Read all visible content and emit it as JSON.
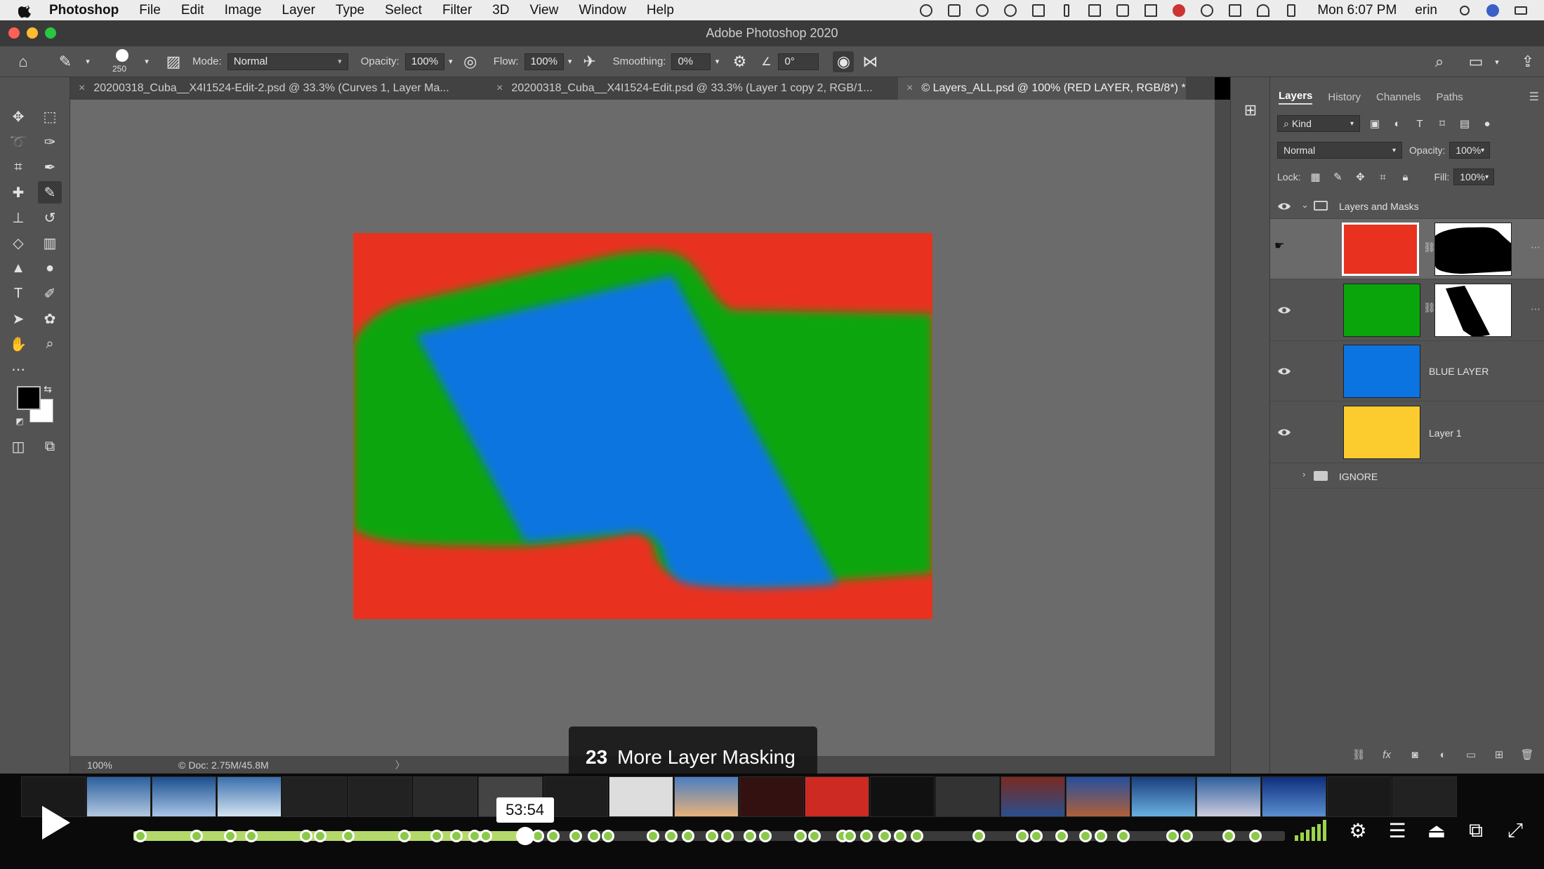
{
  "menubar": {
    "app_name": "Photoshop",
    "items": [
      "File",
      "Edit",
      "Image",
      "Layer",
      "Type",
      "Select",
      "Filter",
      "3D",
      "View",
      "Window",
      "Help"
    ],
    "clock": "Mon 6:07 PM",
    "user": "erin"
  },
  "window": {
    "title": "Adobe Photoshop 2020"
  },
  "options": {
    "brush_size": "250",
    "mode_label": "Mode:",
    "mode_value": "Normal",
    "opacity_label": "Opacity:",
    "opacity_value": "100%",
    "flow_label": "Flow:",
    "flow_value": "100%",
    "smoothing_label": "Smoothing:",
    "smoothing_value": "0%",
    "angle_value": "0°"
  },
  "tabs": [
    {
      "label": "20200318_Cuba__X4I1524-Edit-2.psd @ 33.3% (Curves 1, Layer Ma..."
    },
    {
      "label": "20200318_Cuba__X4I1524-Edit.psd @ 33.3% (Layer 1 copy 2, RGB/1..."
    },
    {
      "label": "© Layers_ALL.psd @ 100% (RED LAYER, RGB/8*) *"
    }
  ],
  "status": {
    "zoom": "100%",
    "doc": "Doc: 2.75M/45.8M",
    "arrow": "〉"
  },
  "colors": {
    "red": "#e8321f",
    "green": "#0aa50a",
    "blue": "#0b74e0",
    "yellow": "#fccc2e",
    "accent": "#9cd44e"
  },
  "layers_panel": {
    "tabs": [
      "Layers",
      "History",
      "Channels",
      "Paths"
    ],
    "filter_label": "Kind",
    "blend_mode": "Normal",
    "opacity_label": "Opacity:",
    "opacity_value": "100%",
    "lock_label": "Lock:",
    "fill_label": "Fill:",
    "fill_value": "100%",
    "group_name": "Layers and Masks",
    "layers": [
      {
        "name": "",
        "color": "#e8321f",
        "has_mask": true,
        "selected": true
      },
      {
        "name": "",
        "color": "#0aa50a",
        "has_mask": true,
        "selected": false
      },
      {
        "name": "BLUE LAYER",
        "color": "#0b74e0",
        "has_mask": false,
        "selected": false
      },
      {
        "name": "Layer 1",
        "color": "#fccc2e",
        "has_mask": false,
        "selected": false
      }
    ],
    "ignore_group": "IGNORE"
  },
  "player": {
    "current_time": "53:54",
    "chapter_number": "23",
    "chapter_title": "More Layer Masking",
    "progress": 0.34
  }
}
